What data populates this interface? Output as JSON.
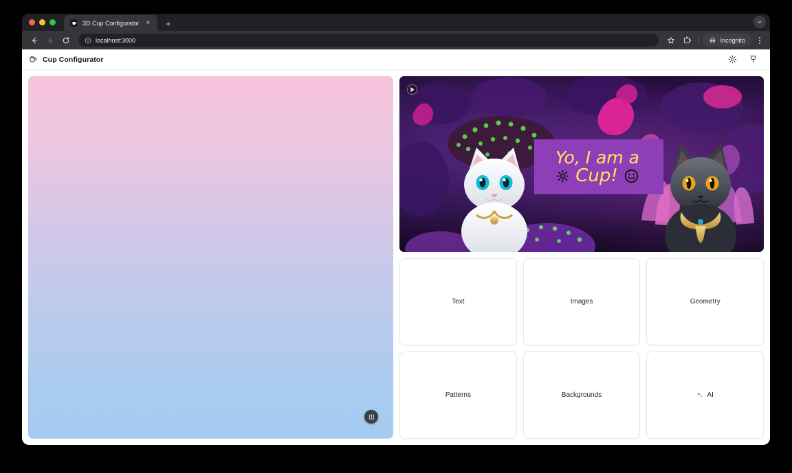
{
  "browser": {
    "tab": {
      "title": "3D Cup Configurator",
      "favicon": "cup-favicon",
      "close_label": "×"
    },
    "new_tab_label": "+",
    "tabstrip_chevron": "⌄",
    "toolbar": {
      "back_label": "←",
      "forward_label": "→",
      "reload_label": "⟳",
      "url": "localhost:3000",
      "site_info_icon": "info-circle-icon",
      "bookmark_icon": "star-icon",
      "extensions_icon": "extensions-icon",
      "incognito_label": "Incognito",
      "incognito_icon": "incognito-icon",
      "menu_icon": "kebab-menu-icon"
    }
  },
  "app": {
    "title": "Cup Configurator",
    "logo_icon": "cup-icon",
    "header_actions": [
      {
        "name": "theme-toggle",
        "icon": "sun-icon"
      },
      {
        "name": "pin-toggle",
        "icon": "pin-icon"
      }
    ]
  },
  "preview": {
    "name": "cup-3d-preview",
    "gradient_top": "#f6c3dc",
    "gradient_bottom": "#a6cbf0",
    "fullscreen_icon": "fullscreen-icon"
  },
  "artwork": {
    "name": "cup-texture-artwork",
    "play_icon": "play-icon",
    "banner": {
      "line1": "Yo, I am a",
      "line2": "Cup!",
      "sun_glyph": "sun-glyph",
      "smiley_glyph": "smiley-glyph",
      "bg_color": "#8e3fb8",
      "text_color": "#ffe35c"
    },
    "scene": {
      "background": "coral-reef-purple",
      "left_subject": "white-kitten",
      "right_subject": "gray-cat"
    }
  },
  "cards": [
    {
      "label": "Text",
      "name": "card-text",
      "icon": null
    },
    {
      "label": "Images",
      "name": "card-images",
      "icon": null
    },
    {
      "label": "Geometry",
      "name": "card-geometry",
      "icon": null
    },
    {
      "label": "Patterns",
      "name": "card-patterns",
      "icon": null
    },
    {
      "label": "Backgrounds",
      "name": "card-backgrounds",
      "icon": null
    },
    {
      "label": "AI",
      "name": "card-ai",
      "icon": "sparkles-icon",
      "icon_color": "#8b5cf6"
    }
  ]
}
